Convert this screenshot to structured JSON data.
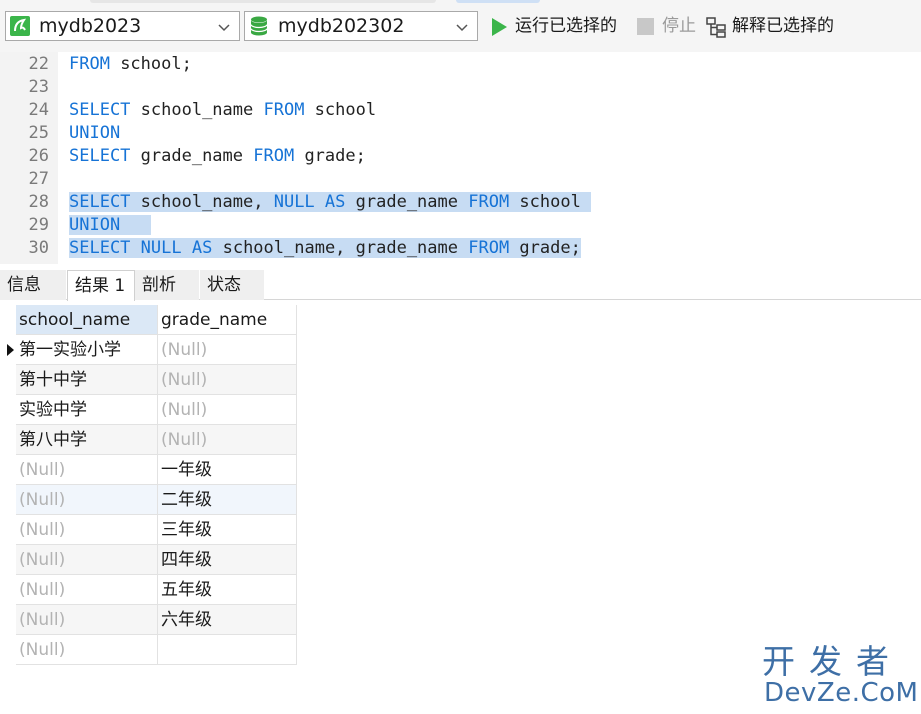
{
  "toolbar": {
    "connection": "mydb2023",
    "database": "mydb202302",
    "run_label": "运行已选择的",
    "stop_label": "停止",
    "explain_label": "解释已选择的",
    "colors": {
      "run": "#3bb54a",
      "db": "#3aa843",
      "accent": "#1673d6"
    }
  },
  "editor": {
    "lines": [
      {
        "num": "22",
        "tokens": [
          [
            "kw",
            "FROM"
          ],
          [
            "t",
            " school;"
          ]
        ]
      },
      {
        "num": "23",
        "tokens": []
      },
      {
        "num": "24",
        "tokens": [
          [
            "kw",
            "SELECT"
          ],
          [
            "t",
            " school_name "
          ],
          [
            "kw",
            "FROM"
          ],
          [
            "t",
            " school"
          ]
        ]
      },
      {
        "num": "25",
        "tokens": [
          [
            "kw",
            "UNION"
          ]
        ]
      },
      {
        "num": "26",
        "tokens": [
          [
            "kw",
            "SELECT"
          ],
          [
            "t",
            " grade_name "
          ],
          [
            "kw",
            "FROM"
          ],
          [
            "t",
            " grade;"
          ]
        ]
      },
      {
        "num": "27",
        "tokens": []
      },
      {
        "num": "28",
        "selected": true,
        "tokens": [
          [
            "kw",
            "SELECT"
          ],
          [
            "t",
            " school_name, "
          ],
          [
            "kw",
            "NULL"
          ],
          [
            "t",
            " "
          ],
          [
            "kw",
            "AS"
          ],
          [
            "t",
            " grade_name "
          ],
          [
            "kw",
            "FROM"
          ],
          [
            "t",
            " school "
          ]
        ]
      },
      {
        "num": "29",
        "selected": true,
        "tokens": [
          [
            "kw",
            "UNION"
          ],
          [
            "t",
            "   "
          ]
        ]
      },
      {
        "num": "30",
        "selected": true,
        "tokens": [
          [
            "kw",
            "SELECT"
          ],
          [
            "t",
            " "
          ],
          [
            "kw",
            "NULL"
          ],
          [
            "t",
            " "
          ],
          [
            "kw",
            "AS"
          ],
          [
            "t",
            " school_name, grade_name "
          ],
          [
            "kw",
            "FROM"
          ],
          [
            "t",
            " grade;"
          ]
        ]
      }
    ]
  },
  "result_tabs": [
    {
      "label": "信息",
      "active": false
    },
    {
      "label": "结果 1",
      "active": true
    },
    {
      "label": "剖析",
      "active": false
    },
    {
      "label": "状态",
      "active": false
    }
  ],
  "grid": {
    "columns": [
      "school_name",
      "grade_name"
    ],
    "null_text": "(Null)",
    "rows": [
      [
        "第一实验小学",
        null
      ],
      [
        "第十中学",
        null
      ],
      [
        "实验中学",
        null
      ],
      [
        "第八中学",
        null
      ],
      [
        null,
        "一年级"
      ],
      [
        null,
        "二年级"
      ],
      [
        null,
        "三年级"
      ],
      [
        null,
        "四年级"
      ],
      [
        null,
        "五年级"
      ],
      [
        null,
        "六年级"
      ],
      [
        null,
        ""
      ]
    ],
    "current_row": 0
  },
  "watermark": {
    "line1": "开发者",
    "line2": "DevZe.CoM"
  }
}
